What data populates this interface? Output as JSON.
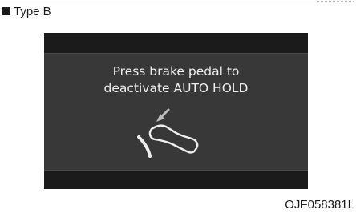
{
  "section": {
    "heading": "Type B",
    "marker_icon": "black-square"
  },
  "display": {
    "message_line1": "Press brake pedal to",
    "message_line2": "deactivate AUTO HOLD",
    "icon": "foot-pressing-brake-pedal-icon",
    "background_color": "#383838",
    "bar_color": "#1b1b1b",
    "text_color": "#eeeeee"
  },
  "figure_code": "OJF058381L"
}
